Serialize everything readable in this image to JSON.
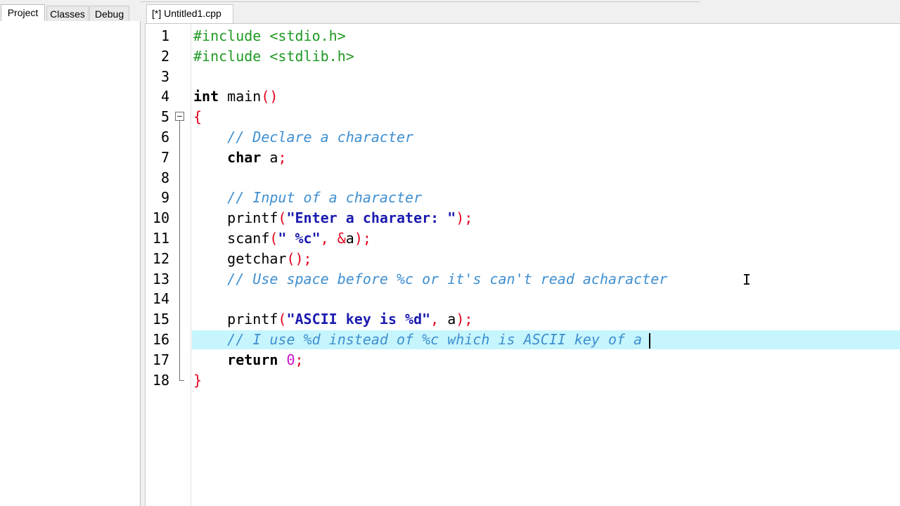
{
  "left_panel": {
    "tabs": [
      {
        "label": "Project",
        "active": true
      },
      {
        "label": "Classes",
        "active": false
      },
      {
        "label": "Debug",
        "active": false
      }
    ]
  },
  "editor": {
    "tab_label": "[*] Untitled1.cpp",
    "current_line": 16,
    "lines": [
      {
        "n": "1",
        "tokens": [
          {
            "t": "pp",
            "v": "#include <stdio.h>"
          }
        ]
      },
      {
        "n": "2",
        "tokens": [
          {
            "t": "pp",
            "v": "#include <stdlib.h>"
          }
        ]
      },
      {
        "n": "3",
        "tokens": []
      },
      {
        "n": "4",
        "tokens": [
          {
            "t": "kw",
            "v": "int"
          },
          {
            "t": "id",
            "v": " main"
          },
          {
            "t": "sy",
            "v": "()"
          }
        ]
      },
      {
        "n": "5",
        "tokens": [
          {
            "t": "sy",
            "v": "{"
          }
        ]
      },
      {
        "n": "6",
        "tokens": [
          {
            "t": "id",
            "v": "    "
          },
          {
            "t": "cm",
            "v": "// Declare a character"
          }
        ]
      },
      {
        "n": "7",
        "tokens": [
          {
            "t": "id",
            "v": "    "
          },
          {
            "t": "kw",
            "v": "char"
          },
          {
            "t": "id",
            "v": " a"
          },
          {
            "t": "sy",
            "v": ";"
          }
        ]
      },
      {
        "n": "8",
        "tokens": []
      },
      {
        "n": "9",
        "tokens": [
          {
            "t": "id",
            "v": "    "
          },
          {
            "t": "cm",
            "v": "// Input of a character"
          }
        ]
      },
      {
        "n": "10",
        "tokens": [
          {
            "t": "id",
            "v": "    printf"
          },
          {
            "t": "sy",
            "v": "("
          },
          {
            "t": "st",
            "v": "\"Enter a charater: \""
          },
          {
            "t": "sy",
            "v": ");"
          }
        ]
      },
      {
        "n": "11",
        "tokens": [
          {
            "t": "id",
            "v": "    scanf"
          },
          {
            "t": "sy",
            "v": "("
          },
          {
            "t": "st",
            "v": "\" %c\""
          },
          {
            "t": "sy",
            "v": ", &"
          },
          {
            "t": "id",
            "v": "a"
          },
          {
            "t": "sy",
            "v": ");"
          }
        ]
      },
      {
        "n": "12",
        "tokens": [
          {
            "t": "id",
            "v": "    getchar"
          },
          {
            "t": "sy",
            "v": "();"
          }
        ]
      },
      {
        "n": "13",
        "tokens": [
          {
            "t": "id",
            "v": "    "
          },
          {
            "t": "cm",
            "v": "// Use space before %c or it's can't read acharacter"
          }
        ]
      },
      {
        "n": "14",
        "tokens": []
      },
      {
        "n": "15",
        "tokens": [
          {
            "t": "id",
            "v": "    printf"
          },
          {
            "t": "sy",
            "v": "("
          },
          {
            "t": "st",
            "v": "\"ASCII key is %d\""
          },
          {
            "t": "sy",
            "v": ", "
          },
          {
            "t": "id",
            "v": "a"
          },
          {
            "t": "sy",
            "v": ");"
          }
        ]
      },
      {
        "n": "16",
        "tokens": [
          {
            "t": "id",
            "v": "    "
          },
          {
            "t": "cm",
            "v": "// I use %d instead of %c which is ASCII key of a"
          }
        ]
      },
      {
        "n": "17",
        "tokens": [
          {
            "t": "id",
            "v": "    "
          },
          {
            "t": "kw",
            "v": "return"
          },
          {
            "t": "id",
            "v": " "
          },
          {
            "t": "nm",
            "v": "0"
          },
          {
            "t": "sy",
            "v": ";"
          }
        ]
      },
      {
        "n": "18",
        "tokens": [
          {
            "t": "sy",
            "v": "}"
          }
        ]
      }
    ]
  }
}
